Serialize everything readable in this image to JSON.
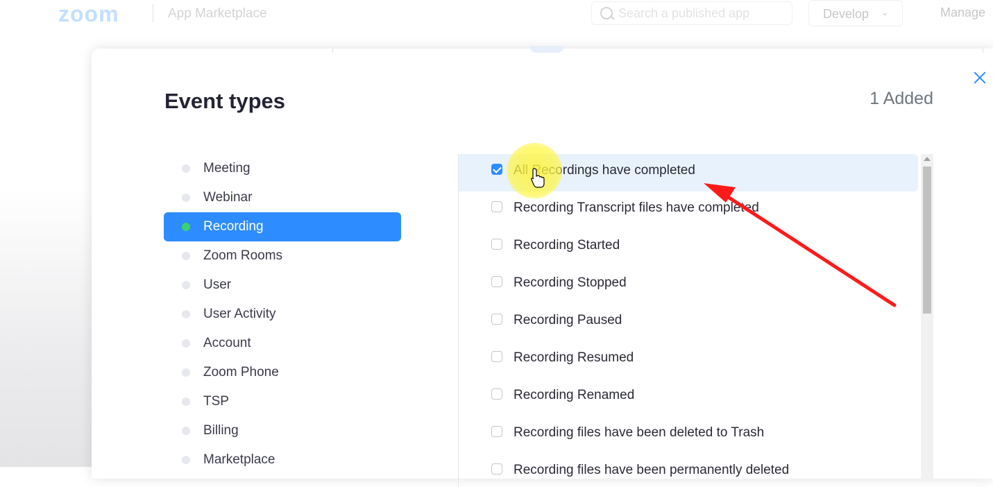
{
  "topnav": {
    "logo": "zoom",
    "title": "App Marketplace",
    "search_placeholder": "Search a published app",
    "develop_label": "Develop",
    "manage_label": "Manage"
  },
  "modal": {
    "title": "Event types",
    "added": "1 Added"
  },
  "categories": [
    {
      "label": "Meeting",
      "active": false
    },
    {
      "label": "Webinar",
      "active": false
    },
    {
      "label": "Recording",
      "active": true
    },
    {
      "label": "Zoom Rooms",
      "active": false
    },
    {
      "label": "User",
      "active": false
    },
    {
      "label": "User Activity",
      "active": false
    },
    {
      "label": "Account",
      "active": false
    },
    {
      "label": "Zoom Phone",
      "active": false
    },
    {
      "label": "TSP",
      "active": false
    },
    {
      "label": "Billing",
      "active": false
    },
    {
      "label": "Marketplace",
      "active": false
    }
  ],
  "events": [
    {
      "label": "All Recordings have completed",
      "checked": true
    },
    {
      "label": "Recording Transcript files have completed",
      "checked": false
    },
    {
      "label": "Recording Started",
      "checked": false
    },
    {
      "label": "Recording Stopped",
      "checked": false
    },
    {
      "label": "Recording Paused",
      "checked": false
    },
    {
      "label": "Recording Resumed",
      "checked": false
    },
    {
      "label": "Recording Renamed",
      "checked": false
    },
    {
      "label": "Recording files have been deleted to Trash",
      "checked": false
    },
    {
      "label": "Recording files have been permanently deleted",
      "checked": false
    }
  ],
  "colors": {
    "accent": "#2D8CFF",
    "active_dot": "#3bd16f",
    "arrow": "#ff1a1a",
    "highlight": "#fff53c"
  }
}
